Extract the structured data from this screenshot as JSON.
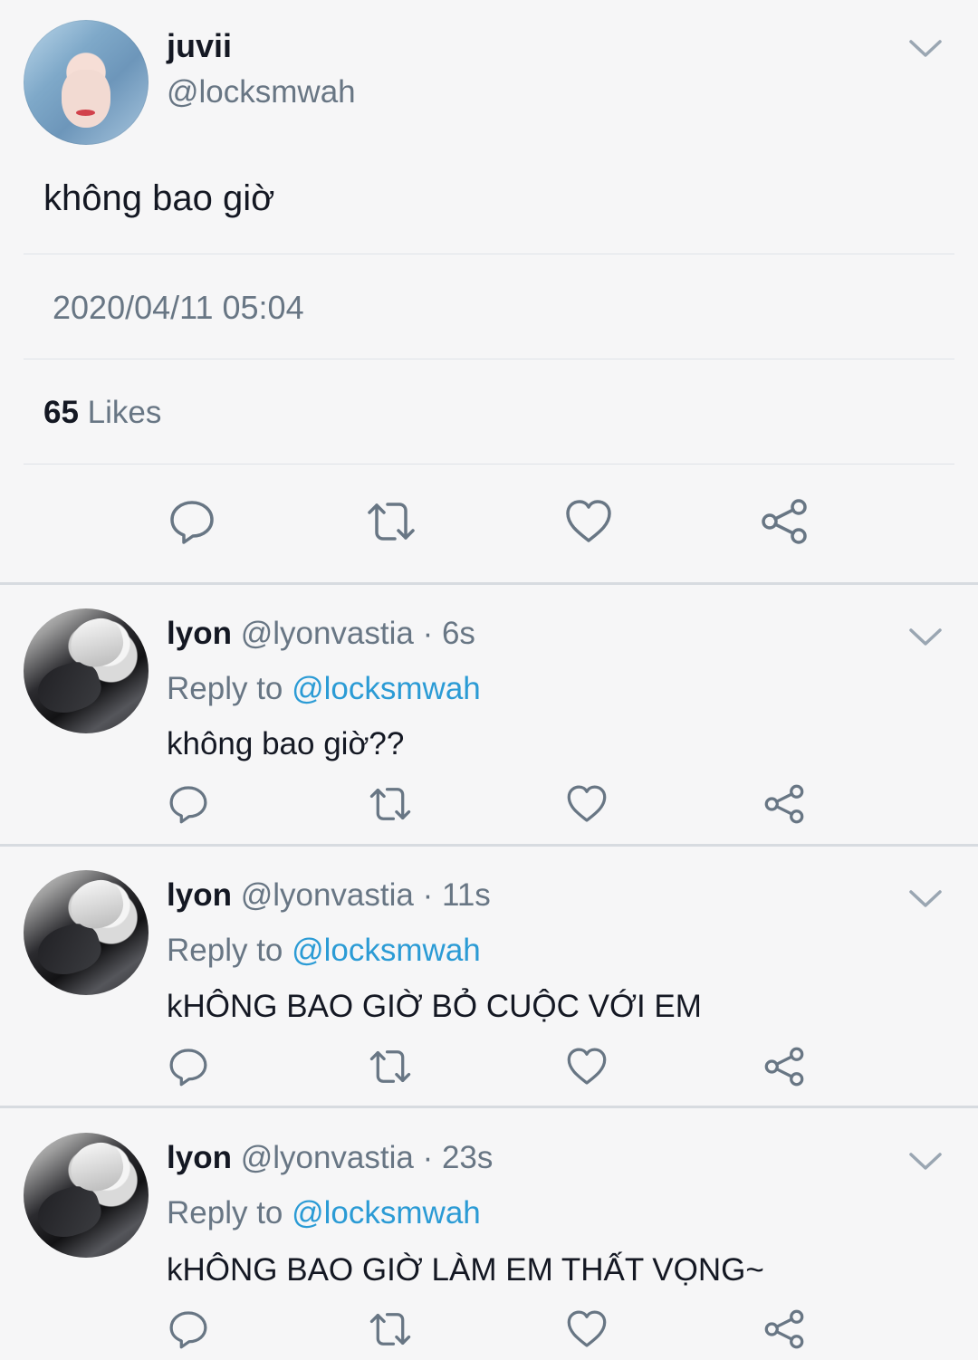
{
  "tweet": {
    "author": {
      "name": "juvii",
      "handle": "@locksmwah"
    },
    "text": "không bao giờ",
    "timestamp": "2020/04/11 05:04",
    "likes": {
      "count": "65",
      "label": "Likes"
    },
    "actions": [
      "reply-icon",
      "retweet-icon",
      "heart-icon",
      "share-icon"
    ]
  },
  "replies": [
    {
      "name": "lyon",
      "handle": "@lyonvastia",
      "time": " · 6s",
      "reply_to_label": "Reply to ",
      "reply_to_handle": "@locksmwah",
      "text": "không bao giờ??"
    },
    {
      "name": "lyon",
      "handle": "@lyonvastia",
      "time": " · 11s",
      "reply_to_label": "Reply to ",
      "reply_to_handle": "@locksmwah",
      "text": "kHÔNG BAO GIỜ BỎ CUỘC VỚI EM"
    },
    {
      "name": "lyon",
      "handle": "@lyonvastia",
      "time": " · 23s",
      "reply_to_label": "Reply to ",
      "reply_to_handle": "@locksmwah",
      "text": "kHÔNG BAO GIỜ LÀM EM THẤT VỌNG~"
    }
  ],
  "colors": {
    "background": "#f6f6f7",
    "primary_text": "#141823",
    "secondary_text": "#687684",
    "link": "#2b9bd5",
    "icon": "#687684"
  }
}
